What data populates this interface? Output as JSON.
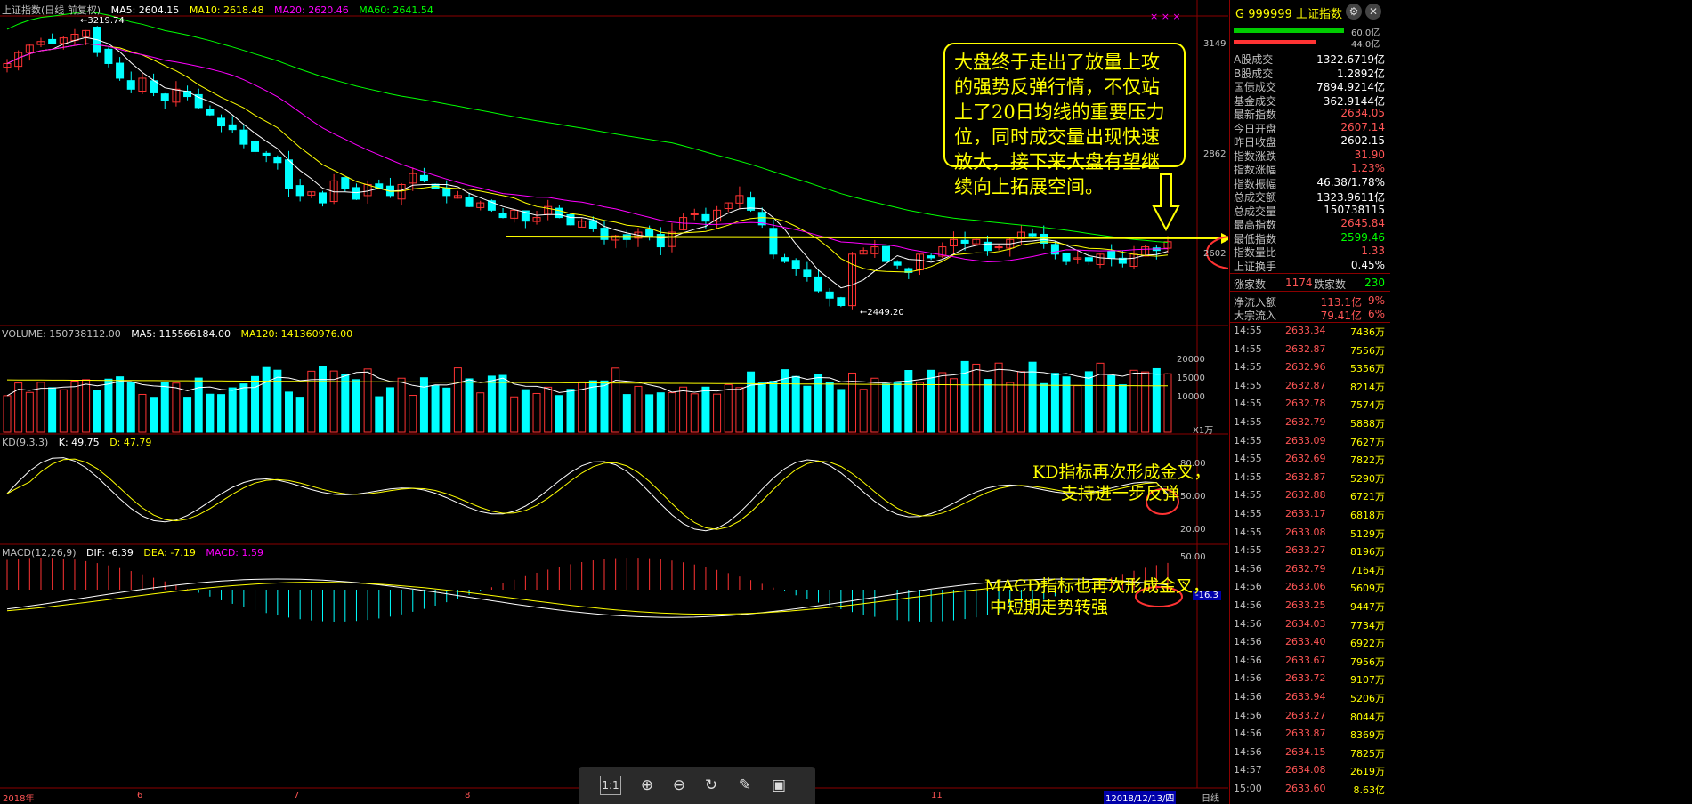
{
  "main_header": {
    "name": "上证指数(日线 前复权)",
    "ma5": "MA5: 2604.15",
    "ma10": "MA10: 2618.48",
    "ma20": "MA20: 2620.46",
    "ma60": "MA60: 2641.54"
  },
  "volume_header": {
    "volume": "VOLUME: 150738112.00",
    "ma5": "MA5: 115566184.00",
    "ma120": "MA120: 141360976.00"
  },
  "kd_header": {
    "name": "KD(9,3,3)",
    "k": "K: 49.75",
    "d": "D: 47.79"
  },
  "macd_header": {
    "name": "MACD(12,26,9)",
    "dif": "DIF: -6.39",
    "dea": "DEA: -7.19",
    "macd": "MACD: 1.59"
  },
  "annotations": {
    "high_label": "←3219.74",
    "low_label": "←2449.20",
    "callout": "大盘终于走出了放量上攻的强势反弹行情，不仅站上了20日均线的重要压力位，同时成交量出现快速放大，接下来大盘有望继续向上拓展空间。",
    "kd_note_1": "KD指标再次形成金叉，",
    "kd_note_2": "支持进一步反弹",
    "macd_note_1": "MACD指标也再次形成金叉，",
    "macd_note_2": "中短期走势转强",
    "stars": "× × ×"
  },
  "axis_labels": {
    "main": [
      "3149",
      "2862",
      "2602"
    ],
    "volume": [
      "20000",
      "15000",
      "10000",
      "X1万"
    ],
    "kd": [
      "80.00",
      "50.00",
      "20.00"
    ],
    "macd": [
      "50.00",
      "-16.3"
    ]
  },
  "x_labels": [
    "2018年",
    "6",
    "7",
    "8",
    "11",
    "12018/12/13/四",
    "日线"
  ],
  "toolbar": [
    "1:1",
    "zoom-in",
    "zoom-out",
    "refresh",
    "draw",
    "save"
  ],
  "right_panel": {
    "code": "G  999999  上证指数",
    "bar_labels": [
      "60.0亿",
      "44.0亿"
    ],
    "rows": [
      {
        "k": "A股成交",
        "v": "1322.6719亿",
        "c": "#ffffff"
      },
      {
        "k": "B股成交",
        "v": "1.2892亿",
        "c": "#ffffff"
      },
      {
        "k": "国债成交",
        "v": "7894.9214亿",
        "c": "#ffffff"
      },
      {
        "k": "基金成交",
        "v": "362.9144亿",
        "c": "#ffffff"
      },
      {
        "k": "最新指数",
        "v": "2634.05",
        "c": "#ff5555"
      },
      {
        "k": "今日开盘",
        "v": "2607.14",
        "c": "#ff5555"
      },
      {
        "k": "昨日收盘",
        "v": "2602.15",
        "c": "#ffffff"
      },
      {
        "k": "指数涨跌",
        "v": "31.90",
        "c": "#ff5555"
      },
      {
        "k": "指数涨幅",
        "v": "1.23%",
        "c": "#ff5555"
      },
      {
        "k": "指数振幅",
        "v": "46.38/1.78%",
        "c": "#ffffff"
      },
      {
        "k": "总成交额",
        "v": "1323.9611亿",
        "c": "#ffffff"
      },
      {
        "k": "总成交量",
        "v": "150738115",
        "c": "#ffffff"
      },
      {
        "k": "最高指数",
        "v": "2645.84",
        "c": "#ff5555"
      },
      {
        "k": "最低指数",
        "v": "2599.46",
        "c": "#00ff00"
      },
      {
        "k": "指数量比",
        "v": "1.33",
        "c": "#ff5555"
      },
      {
        "k": "上证换手",
        "v": "0.45%",
        "c": "#ffffff"
      }
    ],
    "breadth": {
      "up_label": "涨家数",
      "up": "1174",
      "down_label": "跌家数",
      "down": "230"
    },
    "flows": [
      {
        "k": "净流入额",
        "v": "113.1亿",
        "p": "9%"
      },
      {
        "k": "大宗流入",
        "v": "79.41亿",
        "p": "6%"
      }
    ],
    "ticks": [
      [
        "14:55",
        "2633.34",
        "7436万"
      ],
      [
        "14:55",
        "2632.87",
        "7556万"
      ],
      [
        "14:55",
        "2632.96",
        "5356万"
      ],
      [
        "14:55",
        "2632.87",
        "8214万"
      ],
      [
        "14:55",
        "2632.78",
        "7574万"
      ],
      [
        "14:55",
        "2632.79",
        "5888万"
      ],
      [
        "14:55",
        "2633.09",
        "7627万"
      ],
      [
        "14:55",
        "2632.69",
        "7822万"
      ],
      [
        "14:55",
        "2632.87",
        "5290万"
      ],
      [
        "14:55",
        "2632.88",
        "6721万"
      ],
      [
        "14:55",
        "2633.17",
        "6818万"
      ],
      [
        "14:55",
        "2633.08",
        "5129万"
      ],
      [
        "14:55",
        "2633.27",
        "8196万"
      ],
      [
        "14:56",
        "2632.79",
        "7164万"
      ],
      [
        "14:56",
        "2633.06",
        "5609万"
      ],
      [
        "14:56",
        "2633.25",
        "9447万"
      ],
      [
        "14:56",
        "2634.03",
        "7734万"
      ],
      [
        "14:56",
        "2633.40",
        "6922万"
      ],
      [
        "14:56",
        "2633.67",
        "7956万"
      ],
      [
        "14:56",
        "2633.72",
        "9107万"
      ],
      [
        "14:56",
        "2633.94",
        "5206万"
      ],
      [
        "14:56",
        "2633.27",
        "8044万"
      ],
      [
        "14:56",
        "2633.87",
        "8369万"
      ],
      [
        "14:56",
        "2634.15",
        "7825万"
      ],
      [
        "14:57",
        "2634.08",
        "2619万"
      ],
      [
        "15:00",
        "2633.60",
        "8.63亿"
      ]
    ]
  },
  "chart_data": {
    "type": "candlestick",
    "title": "上证指数(日线 前复权)",
    "x_range": [
      "2018年",
      "2018/12/13"
    ],
    "price_axis_ticks": [
      3149,
      2862,
      2602
    ],
    "highest": 3219.74,
    "lowest": 2449.2,
    "closes": [
      3120,
      3150,
      3170,
      3180,
      3175,
      3190,
      3200,
      3210,
      3150,
      3120,
      3080,
      3050,
      3080,
      3040,
      3020,
      3050,
      3030,
      3000,
      2980,
      2950,
      2940,
      2900,
      2880,
      2870,
      2850,
      2780,
      2760,
      2770,
      2740,
      2800,
      2780,
      2750,
      2790,
      2780,
      2760,
      2790,
      2820,
      2800,
      2780,
      2760,
      2760,
      2730,
      2740,
      2720,
      2700,
      2720,
      2690,
      2700,
      2730,
      2700,
      2680,
      2690,
      2670,
      2640,
      2650,
      2640,
      2660,
      2650,
      2620,
      2660,
      2700,
      2710,
      2690,
      2720,
      2740,
      2760,
      2720,
      2680,
      2600,
      2580,
      2560,
      2540,
      2500,
      2480,
      2460,
      2600,
      2610,
      2620,
      2580,
      2570,
      2550,
      2600,
      2590,
      2620,
      2640,
      2630,
      2640,
      2610,
      2620,
      2640,
      2660,
      2650,
      2630,
      2600,
      2580,
      2590,
      2580,
      2600,
      2590,
      2575,
      2600,
      2620,
      2610,
      2634
    ],
    "volume": {
      "ma5": 115566184.0,
      "ma120": 141360976.0,
      "last": 150738112.0
    },
    "kd": {
      "k": 49.75,
      "d": 47.79
    },
    "macd": {
      "dif": -6.39,
      "dea": -7.19,
      "macd": 1.59
    },
    "colors": {
      "up": "#ff3333",
      "down": "#00ffff",
      "ma5": "#ffffff",
      "ma10": "#ffff00",
      "ma20": "#ff00ff",
      "ma60": "#00ff00"
    }
  }
}
